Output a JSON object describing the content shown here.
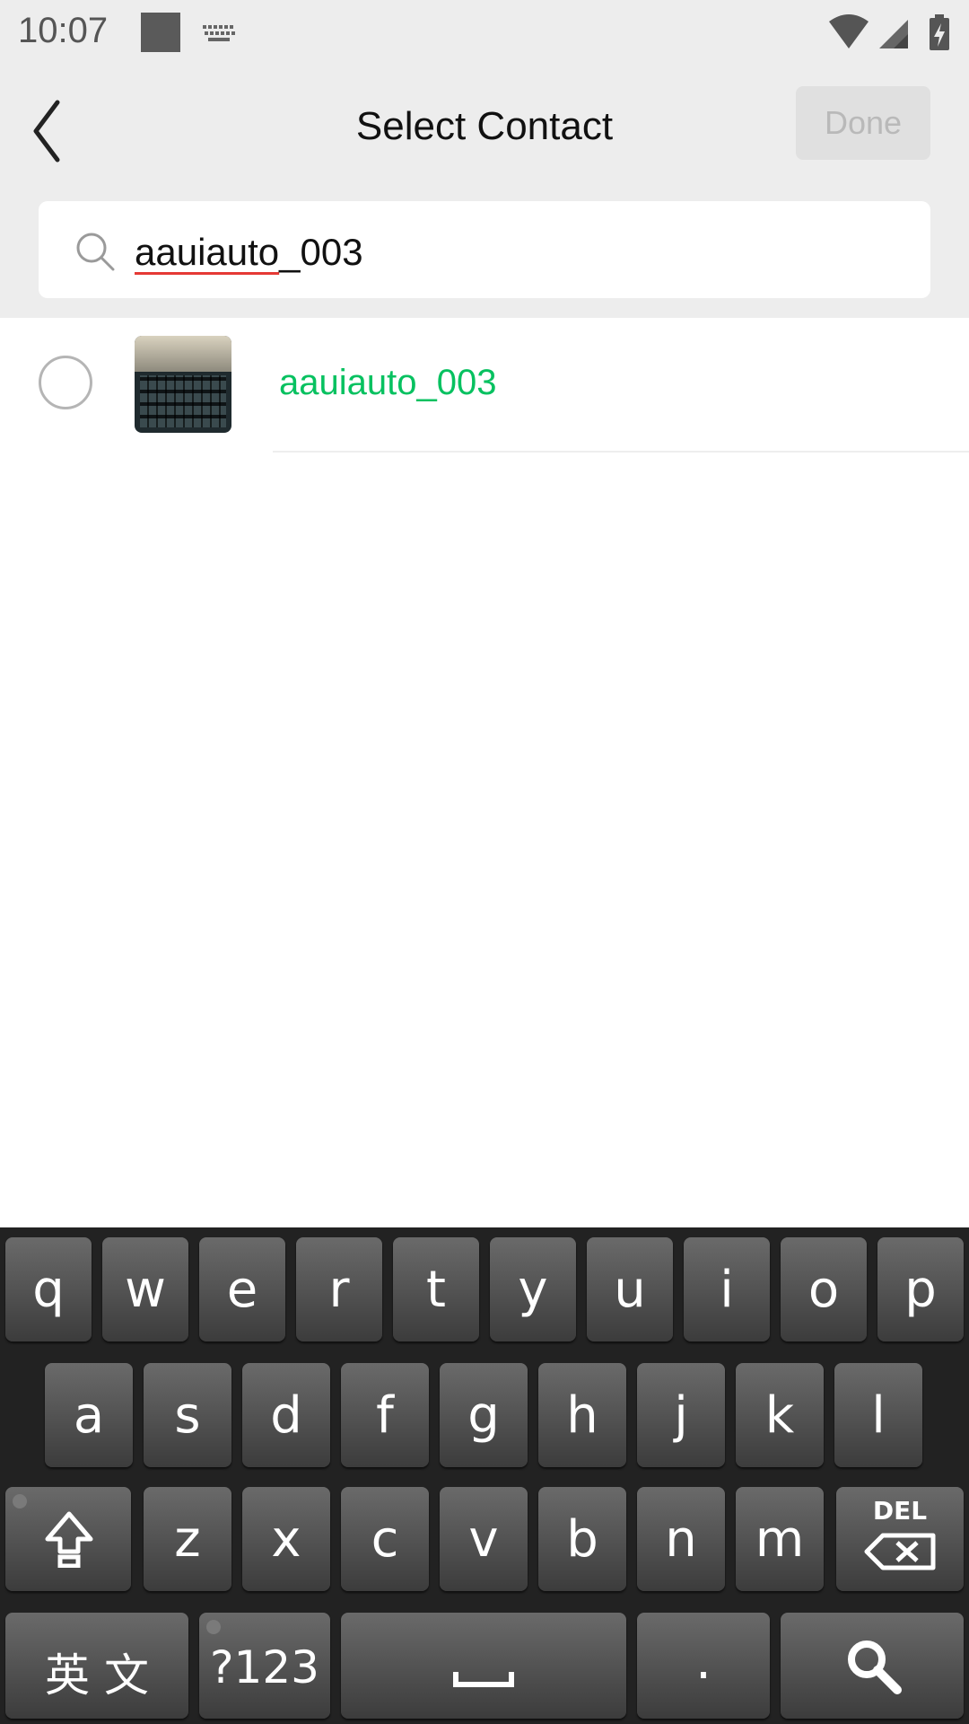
{
  "status_bar": {
    "time": "10:07"
  },
  "header": {
    "title": "Select Contact",
    "done_label": "Done"
  },
  "search": {
    "query_misspelled": "aauiauto",
    "query_rest": "_003"
  },
  "results": [
    {
      "name": "aauiauto_003"
    }
  ],
  "keyboard": {
    "row1": [
      "q",
      "w",
      "e",
      "r",
      "t",
      "y",
      "u",
      "i",
      "o",
      "p"
    ],
    "row2": [
      "a",
      "s",
      "d",
      "f",
      "g",
      "h",
      "j",
      "k",
      "l"
    ],
    "row3": [
      "z",
      "x",
      "c",
      "v",
      "b",
      "n",
      "m"
    ],
    "lang_label": "英 文",
    "sym_label": "?123",
    "del_label": "DEL",
    "period_label": "."
  }
}
